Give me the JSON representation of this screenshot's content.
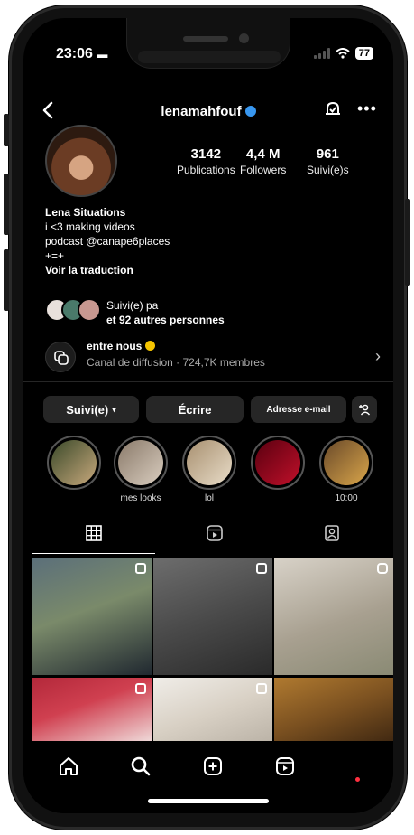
{
  "status": {
    "time": "23:06",
    "battery": "77"
  },
  "profile": {
    "username": "lenamahfouf",
    "stats": [
      {
        "value": "3142",
        "label": "Publications"
      },
      {
        "value": "4,4 M",
        "label": "Followers"
      },
      {
        "value": "961",
        "label": "Suivi(e)s"
      }
    ],
    "bio": {
      "name": "Lena Situations",
      "line1": "i <3 making videos",
      "line2": "podcast @canape6places",
      "line3": "+=+",
      "translate": "Voir la traduction"
    },
    "followed_by": {
      "line1": "Suivi(e) pa",
      "line2": "et 92 autres personnes"
    },
    "channel": {
      "title": "entre nous",
      "subtitle": "Canal de diffusion · 724,7K membres"
    },
    "actions": {
      "following": "Suivi(e)",
      "message": "Écrire",
      "email": "Adresse e-mail"
    }
  },
  "highlights": [
    {
      "label": "",
      "colors": [
        "#3b4a2a",
        "#c7a87c"
      ]
    },
    {
      "label": "mes looks",
      "colors": [
        "#8a7a6a",
        "#d9cdbf"
      ]
    },
    {
      "label": "lol",
      "colors": [
        "#a89070",
        "#e8dcc8"
      ]
    },
    {
      "label": "",
      "colors": [
        "#5a0010",
        "#c0102a"
      ]
    },
    {
      "label": "10:00",
      "colors": [
        "#6a4a2a",
        "#d9a54a"
      ]
    }
  ],
  "grid": [
    {
      "colors": [
        "#5b6f7a",
        "#202830"
      ]
    },
    {
      "colors": [
        "#6d6d6d",
        "#2a2a2a"
      ]
    },
    {
      "colors": [
        "#d8d2c8",
        "#8a8a74"
      ]
    },
    {
      "colors": [
        "#b3283a",
        "#f2e8e6"
      ]
    },
    {
      "colors": [
        "#f0ede8",
        "#b8b0a4"
      ]
    },
    {
      "colors": [
        "#b07a30",
        "#3a2410"
      ]
    }
  ]
}
